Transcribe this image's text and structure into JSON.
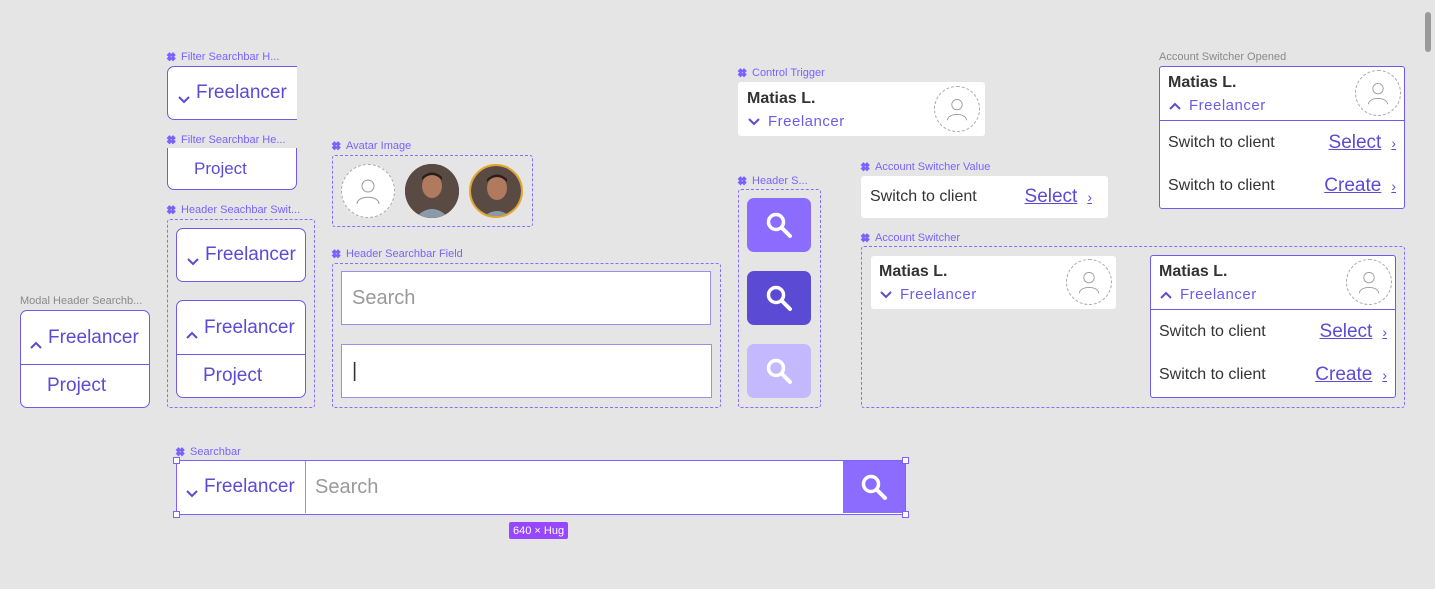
{
  "labels": {
    "filter_h1": "Filter Searchbar H...",
    "filter_h2": "Filter Searchbar He...",
    "header_switch": "Header Seachbar Swit...",
    "modal_header": "Modal Header Searchb...",
    "avatar_image": "Avatar Image",
    "header_field": "Header Searchbar Field",
    "control_trigger": "Control Trigger",
    "header_s": "Header S...",
    "switcher_value": "Account Switcher Value",
    "switcher": "Account Switcher",
    "switcher_opened": "Account Switcher Opened",
    "searchbar": "Searchbar",
    "size_badge": "640 × Hug"
  },
  "roles": {
    "freelancer": "Freelancer",
    "project": "Project"
  },
  "search": {
    "placeholder": "Search",
    "cursor": "|"
  },
  "account": {
    "name": "Matias L.",
    "role": "Freelancer",
    "switch_text": "Switch to client",
    "select": "Select",
    "create": "Create"
  },
  "colors": {
    "accent": "#8b6cff",
    "accent_dark": "#5b4bd4",
    "accent_light": "#c4b8ff",
    "canvas": "#e5e5e5"
  }
}
